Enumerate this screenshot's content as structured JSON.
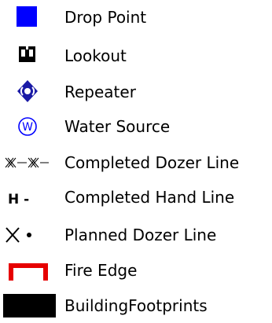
{
  "legend": {
    "items": [
      {
        "label": "Drop Point",
        "icon": "drop-point-square",
        "color": "#0000ff"
      },
      {
        "label": "Lookout",
        "icon": "binoculars",
        "color": "#000000"
      },
      {
        "label": "Repeater",
        "icon": "repeater-diamond",
        "color": "#1a1aa6"
      },
      {
        "label": "Water Source",
        "icon": "water-source-circle-w",
        "color": "#0000ff"
      },
      {
        "label": "Completed Dozer Line",
        "icon": "completed-dozer-line-symbol",
        "color": "#000000"
      },
      {
        "label": "Completed Hand Line",
        "icon": "completed-hand-line-symbol",
        "color": "#000000"
      },
      {
        "label": "Planned Dozer Line",
        "icon": "planned-dozer-line-symbol",
        "color": "#000000"
      },
      {
        "label": "Fire Edge",
        "icon": "fire-edge-bracket",
        "color": "#e60000"
      },
      {
        "label": "BuildingFootprints",
        "icon": "building-footprint-rect",
        "color": "#000000"
      }
    ],
    "symbol_text": {
      "water_source_letter": "W",
      "hand_line_glyph": "H -"
    }
  }
}
